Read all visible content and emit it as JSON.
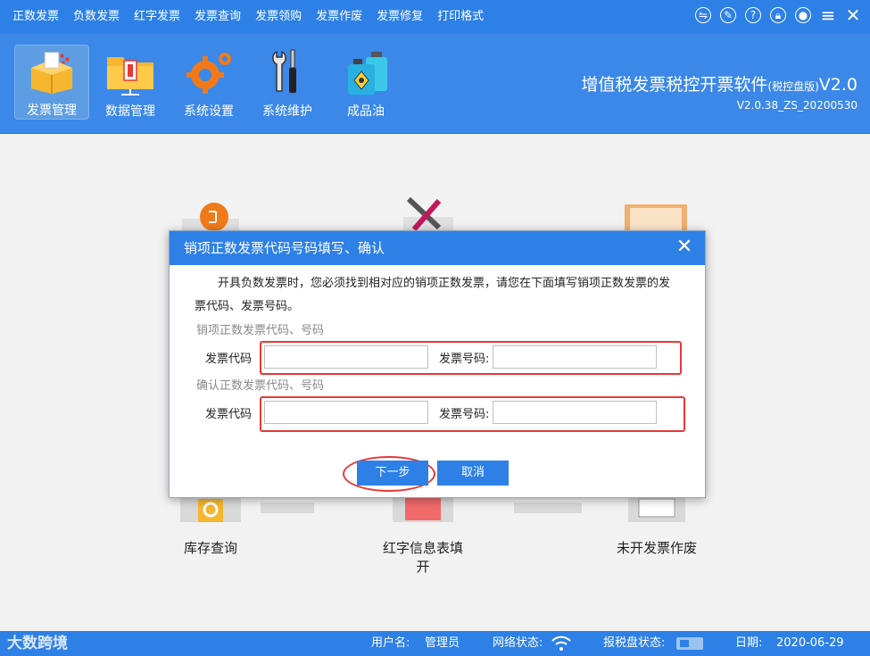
{
  "menu": {
    "items": [
      "正数发票",
      "负数发票",
      "红字发票",
      "发票查询",
      "发票领购",
      "发票作废",
      "发票修复",
      "打印格式"
    ]
  },
  "window_controls": [
    "swap-icon",
    "edit-icon",
    "help-icon",
    "lock-icon",
    "user-icon",
    "menu-icon",
    "close-icon"
  ],
  "toolbar": {
    "tools": [
      {
        "label": "发票管理",
        "icon": "invoice-box-icon",
        "active": true
      },
      {
        "label": "数据管理",
        "icon": "folder-data-icon",
        "active": false
      },
      {
        "label": "系统设置",
        "icon": "gear-icon",
        "active": false
      },
      {
        "label": "系统维护",
        "icon": "tools-icon",
        "active": false
      },
      {
        "label": "成品油",
        "icon": "oil-can-icon",
        "active": false
      }
    ]
  },
  "brand": {
    "title": "增值税发票税控开票软件",
    "edition": "(税控盘版)",
    "version_suffix": "V2.0",
    "build": "V2.0.38_ZS_20200530"
  },
  "modules": {
    "stock_query": "库存查询",
    "red_info_fill_line1": "红字信息表填",
    "red_info_fill_line2": "开",
    "unissued_void": "未开发票作废"
  },
  "dialog": {
    "title": "销项正数发票代码号码填写、确认",
    "message": "开具负数发票时，您必须找到相对应的销项正数发票，请您在下面填写销项正数发票的发票代码、发票号码。",
    "section1_title": "销项正数发票代码、号码",
    "section2_title": "确认正数发票代码、号码",
    "code_label": "发票代码",
    "number_label": "发票号码:",
    "code1_value": "",
    "number1_value": "",
    "code2_value": "",
    "number2_value": "",
    "next_label": "下一步",
    "cancel_label": "取消"
  },
  "status": {
    "user_label": "用户名:",
    "user_value": "管理员",
    "network_label": "网络状态:",
    "disk_label": "报税盘状态:",
    "date_label": "日期:",
    "date_value": "2020-06-29",
    "watermark": "大数跨境"
  },
  "colors": {
    "primary": "#2d80e6",
    "highlight_red": "#e53935"
  }
}
